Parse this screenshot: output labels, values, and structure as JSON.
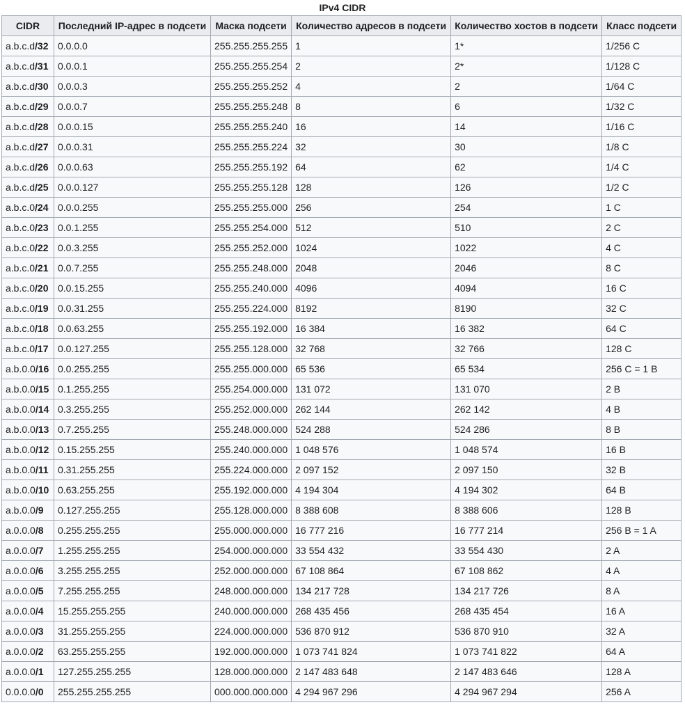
{
  "table": {
    "caption": "IPv4 CIDR",
    "headers": [
      "CIDR",
      "Последний IP-адрес в подсети",
      "Маска подсети",
      "Количество адресов в подсети",
      "Количество хостов в подсети",
      "Класс подсети"
    ],
    "rows": [
      {
        "base": "a.b.c.d",
        "prefix": "/32",
        "last_ip": "0.0.0.0",
        "mask": "255.255.255.255",
        "addresses": "1",
        "hosts": "1*",
        "class": "1/256 C"
      },
      {
        "base": "a.b.c.d",
        "prefix": "/31",
        "last_ip": "0.0.0.1",
        "mask": "255.255.255.254",
        "addresses": "2",
        "hosts": "2*",
        "class": "1/128 C"
      },
      {
        "base": "a.b.c.d",
        "prefix": "/30",
        "last_ip": "0.0.0.3",
        "mask": "255.255.255.252",
        "addresses": "4",
        "hosts": "2",
        "class": "1/64 C"
      },
      {
        "base": "a.b.c.d",
        "prefix": "/29",
        "last_ip": "0.0.0.7",
        "mask": "255.255.255.248",
        "addresses": "8",
        "hosts": "6",
        "class": "1/32 C"
      },
      {
        "base": "a.b.c.d",
        "prefix": "/28",
        "last_ip": "0.0.0.15",
        "mask": "255.255.255.240",
        "addresses": "16",
        "hosts": "14",
        "class": "1/16 C"
      },
      {
        "base": "a.b.c.d",
        "prefix": "/27",
        "last_ip": "0.0.0.31",
        "mask": "255.255.255.224",
        "addresses": "32",
        "hosts": "30",
        "class": "1/8 C"
      },
      {
        "base": "a.b.c.d",
        "prefix": "/26",
        "last_ip": "0.0.0.63",
        "mask": "255.255.255.192",
        "addresses": "64",
        "hosts": "62",
        "class": "1/4 C"
      },
      {
        "base": "a.b.c.d",
        "prefix": "/25",
        "last_ip": "0.0.0.127",
        "mask": "255.255.255.128",
        "addresses": "128",
        "hosts": "126",
        "class": "1/2 C"
      },
      {
        "base": "a.b.c.0",
        "prefix": "/24",
        "last_ip": "0.0.0.255",
        "mask": "255.255.255.000",
        "addresses": "256",
        "hosts": "254",
        "class": "1 C"
      },
      {
        "base": "a.b.c.0",
        "prefix": "/23",
        "last_ip": "0.0.1.255",
        "mask": "255.255.254.000",
        "addresses": "512",
        "hosts": "510",
        "class": "2 C"
      },
      {
        "base": "a.b.c.0",
        "prefix": "/22",
        "last_ip": "0.0.3.255",
        "mask": "255.255.252.000",
        "addresses": "1024",
        "hosts": "1022",
        "class": "4 C"
      },
      {
        "base": "a.b.c.0",
        "prefix": "/21",
        "last_ip": "0.0.7.255",
        "mask": "255.255.248.000",
        "addresses": "2048",
        "hosts": "2046",
        "class": "8 C"
      },
      {
        "base": "a.b.c.0",
        "prefix": "/20",
        "last_ip": "0.0.15.255",
        "mask": "255.255.240.000",
        "addresses": "4096",
        "hosts": "4094",
        "class": "16 C"
      },
      {
        "base": "a.b.c.0",
        "prefix": "/19",
        "last_ip": "0.0.31.255",
        "mask": "255.255.224.000",
        "addresses": "8192",
        "hosts": "8190",
        "class": "32 C"
      },
      {
        "base": "a.b.c.0",
        "prefix": "/18",
        "last_ip": "0.0.63.255",
        "mask": "255.255.192.000",
        "addresses": "16 384",
        "hosts": "16 382",
        "class": "64 C"
      },
      {
        "base": "a.b.c.0",
        "prefix": "/17",
        "last_ip": "0.0.127.255",
        "mask": "255.255.128.000",
        "addresses": "32 768",
        "hosts": "32 766",
        "class": "128 C"
      },
      {
        "base": "a.b.0.0",
        "prefix": "/16",
        "last_ip": "0.0.255.255",
        "mask": "255.255.000.000",
        "addresses": "65 536",
        "hosts": "65 534",
        "class": "256 C = 1 B"
      },
      {
        "base": "a.b.0.0",
        "prefix": "/15",
        "last_ip": "0.1.255.255",
        "mask": "255.254.000.000",
        "addresses": "131 072",
        "hosts": "131 070",
        "class": "2 B"
      },
      {
        "base": "a.b.0.0",
        "prefix": "/14",
        "last_ip": "0.3.255.255",
        "mask": "255.252.000.000",
        "addresses": "262 144",
        "hosts": "262 142",
        "class": "4 B"
      },
      {
        "base": "a.b.0.0",
        "prefix": "/13",
        "last_ip": "0.7.255.255",
        "mask": "255.248.000.000",
        "addresses": "524 288",
        "hosts": "524 286",
        "class": "8 B"
      },
      {
        "base": "a.b.0.0",
        "prefix": "/12",
        "last_ip": "0.15.255.255",
        "mask": "255.240.000.000",
        "addresses": "1 048 576",
        "hosts": "1 048 574",
        "class": "16 B"
      },
      {
        "base": "a.b.0.0",
        "prefix": "/11",
        "last_ip": "0.31.255.255",
        "mask": "255.224.000.000",
        "addresses": "2 097 152",
        "hosts": "2 097 150",
        "class": "32 B"
      },
      {
        "base": "a.b.0.0",
        "prefix": "/10",
        "last_ip": "0.63.255.255",
        "mask": "255.192.000.000",
        "addresses": "4 194 304",
        "hosts": "4 194 302",
        "class": "64 B"
      },
      {
        "base": "a.b.0.0",
        "prefix": "/9",
        "last_ip": "0.127.255.255",
        "mask": "255.128.000.000",
        "addresses": "8 388 608",
        "hosts": "8 388 606",
        "class": "128 B"
      },
      {
        "base": "a.0.0.0",
        "prefix": "/8",
        "last_ip": "0.255.255.255",
        "mask": "255.000.000.000",
        "addresses": "16 777 216",
        "hosts": "16 777 214",
        "class": "256 B = 1 A"
      },
      {
        "base": "a.0.0.0",
        "prefix": "/7",
        "last_ip": "1.255.255.255",
        "mask": "254.000.000.000",
        "addresses": "33 554 432",
        "hosts": "33 554 430",
        "class": "2 A"
      },
      {
        "base": "a.0.0.0",
        "prefix": "/6",
        "last_ip": "3.255.255.255",
        "mask": "252.000.000.000",
        "addresses": "67 108 864",
        "hosts": "67 108 862",
        "class": "4 A"
      },
      {
        "base": "a.0.0.0",
        "prefix": "/5",
        "last_ip": "7.255.255.255",
        "mask": "248.000.000.000",
        "addresses": "134 217 728",
        "hosts": "134 217 726",
        "class": "8 A"
      },
      {
        "base": "a.0.0.0",
        "prefix": "/4",
        "last_ip": "15.255.255.255",
        "mask": "240.000.000.000",
        "addresses": "268 435 456",
        "hosts": "268 435 454",
        "class": "16 A"
      },
      {
        "base": "a.0.0.0",
        "prefix": "/3",
        "last_ip": "31.255.255.255",
        "mask": "224.000.000.000",
        "addresses": "536 870 912",
        "hosts": "536 870 910",
        "class": "32 A"
      },
      {
        "base": "a.0.0.0",
        "prefix": "/2",
        "last_ip": "63.255.255.255",
        "mask": "192.000.000.000",
        "addresses": "1 073 741 824",
        "hosts": "1 073 741 822",
        "class": "64 A"
      },
      {
        "base": "a.0.0.0",
        "prefix": "/1",
        "last_ip": "127.255.255.255",
        "mask": "128.000.000.000",
        "addresses": "2 147 483 648",
        "hosts": "2 147 483 646",
        "class": "128 A"
      },
      {
        "base": "0.0.0.0",
        "prefix": "/0",
        "last_ip": "255.255.255.255",
        "mask": "000.000.000.000",
        "addresses": "4 294 967 296",
        "hosts": "4 294 967 294",
        "class": "256 A"
      }
    ]
  }
}
